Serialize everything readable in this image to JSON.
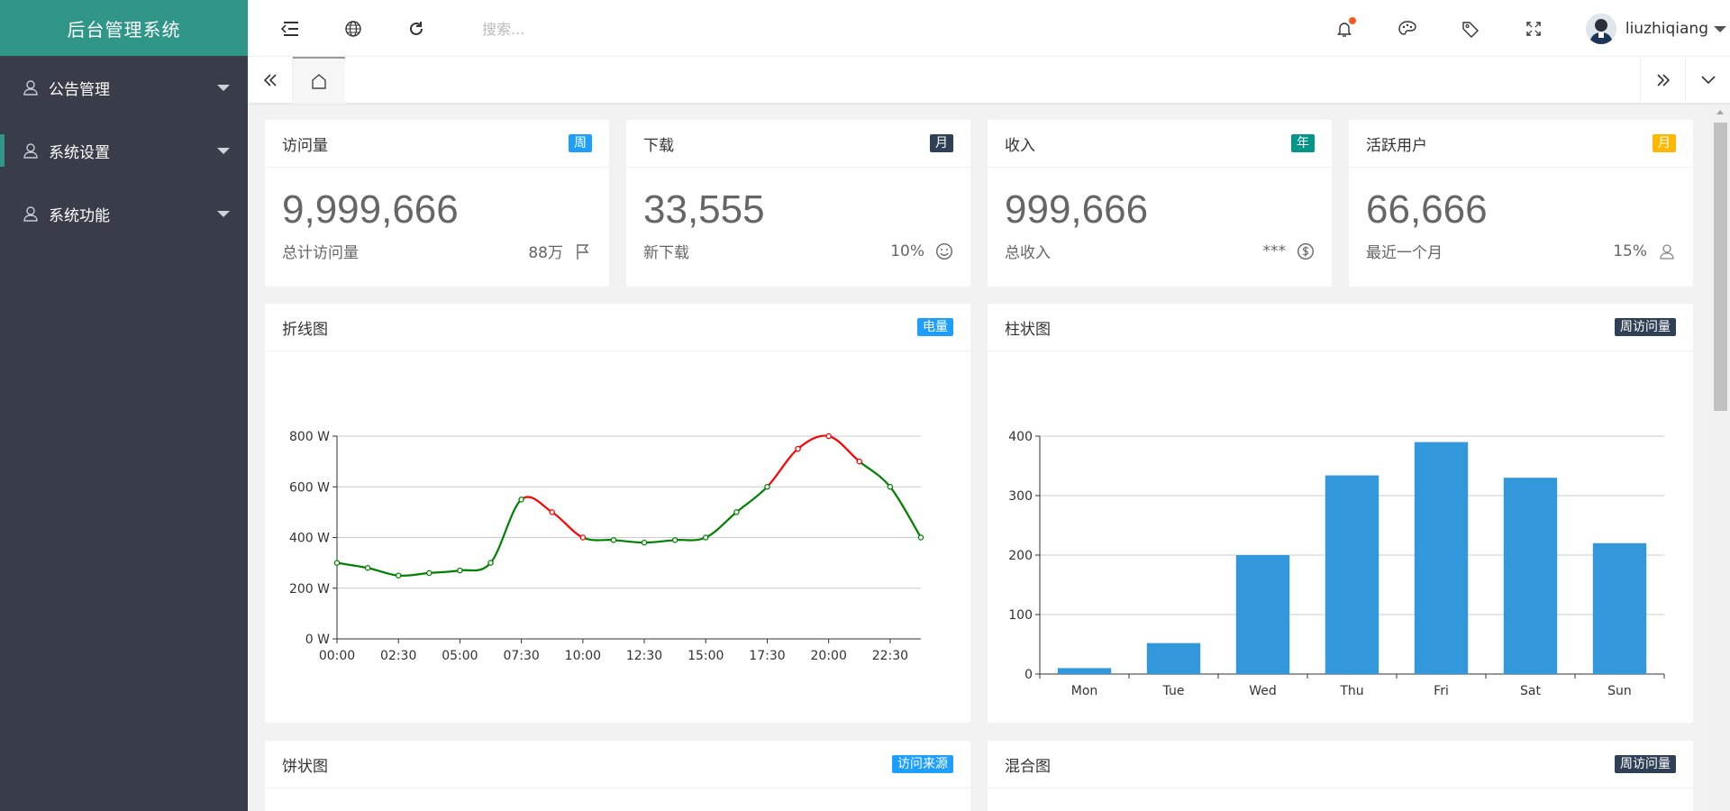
{
  "app": {
    "title": "后台管理系统"
  },
  "sidebar": {
    "items": [
      {
        "label": "公告管理",
        "active": false
      },
      {
        "label": "系统设置",
        "active": true
      },
      {
        "label": "系统功能",
        "active": false
      }
    ]
  },
  "header": {
    "search_placeholder": "搜索...",
    "username": "liuzhiqiang"
  },
  "stats": [
    {
      "title": "访问量",
      "badge": "周",
      "badge_color": "#1e9fff",
      "value": "9,999,666",
      "label": "总计访问量",
      "extra": "88万",
      "icon": "flag-icon"
    },
    {
      "title": "下载",
      "badge": "月",
      "badge_color": "#2f4056",
      "value": "33,555",
      "label": "新下载",
      "extra": "10%",
      "icon": "smile-icon"
    },
    {
      "title": "收入",
      "badge": "年",
      "badge_color": "#009688",
      "value": "999,666",
      "label": "总收入",
      "extra": "***",
      "icon": "dollar-icon"
    },
    {
      "title": "活跃用户",
      "badge": "月",
      "badge_color": "#ffb800",
      "value": "66,666",
      "label": "最近一个月",
      "extra": "15%",
      "icon": "user-icon"
    }
  ],
  "panels": {
    "line": {
      "title": "折线图",
      "badge": "电量",
      "badge_color": "#1e9fff"
    },
    "bar": {
      "title": "柱状图",
      "badge": "周访问量",
      "badge_color": "#2f4056"
    },
    "pie": {
      "title": "饼状图",
      "badge": "访问来源",
      "badge_color": "#1e9fff"
    },
    "mixed": {
      "title": "混合图",
      "badge": "周访问量",
      "badge_color": "#2f4056"
    }
  },
  "chart_data": [
    {
      "type": "line",
      "x": [
        "00:00",
        "01:15",
        "02:30",
        "03:45",
        "05:00",
        "06:15",
        "07:30",
        "08:45",
        "10:00",
        "11:15",
        "12:30",
        "13:45",
        "15:00",
        "16:15",
        "17:30",
        "18:45",
        "20:00",
        "21:15",
        "22:30",
        "23:45"
      ],
      "x_ticks": [
        "00:00",
        "02:30",
        "05:00",
        "07:30",
        "10:00",
        "12:30",
        "15:00",
        "17:30",
        "20:00",
        "22:30"
      ],
      "values": [
        300,
        280,
        250,
        260,
        270,
        300,
        550,
        500,
        400,
        390,
        380,
        390,
        400,
        500,
        600,
        750,
        800,
        700,
        600,
        400
      ],
      "y_ticks": [
        "0 W",
        "200 W",
        "400 W",
        "600 W",
        "800 W"
      ],
      "ylim": [
        0,
        800
      ],
      "highlight_ranges": [
        [
          6,
          8
        ],
        [
          14,
          17
        ]
      ],
      "colors": {
        "normal": "#008000",
        "highlight": "#ff0000"
      }
    },
    {
      "type": "bar",
      "categories": [
        "Mon",
        "Tue",
        "Wed",
        "Thu",
        "Fri",
        "Sat",
        "Sun"
      ],
      "values": [
        10,
        52,
        200,
        334,
        390,
        330,
        220
      ],
      "y_ticks": [
        "0",
        "100",
        "200",
        "300",
        "400"
      ],
      "ylim": [
        0,
        400
      ],
      "color": "#3398db"
    }
  ]
}
